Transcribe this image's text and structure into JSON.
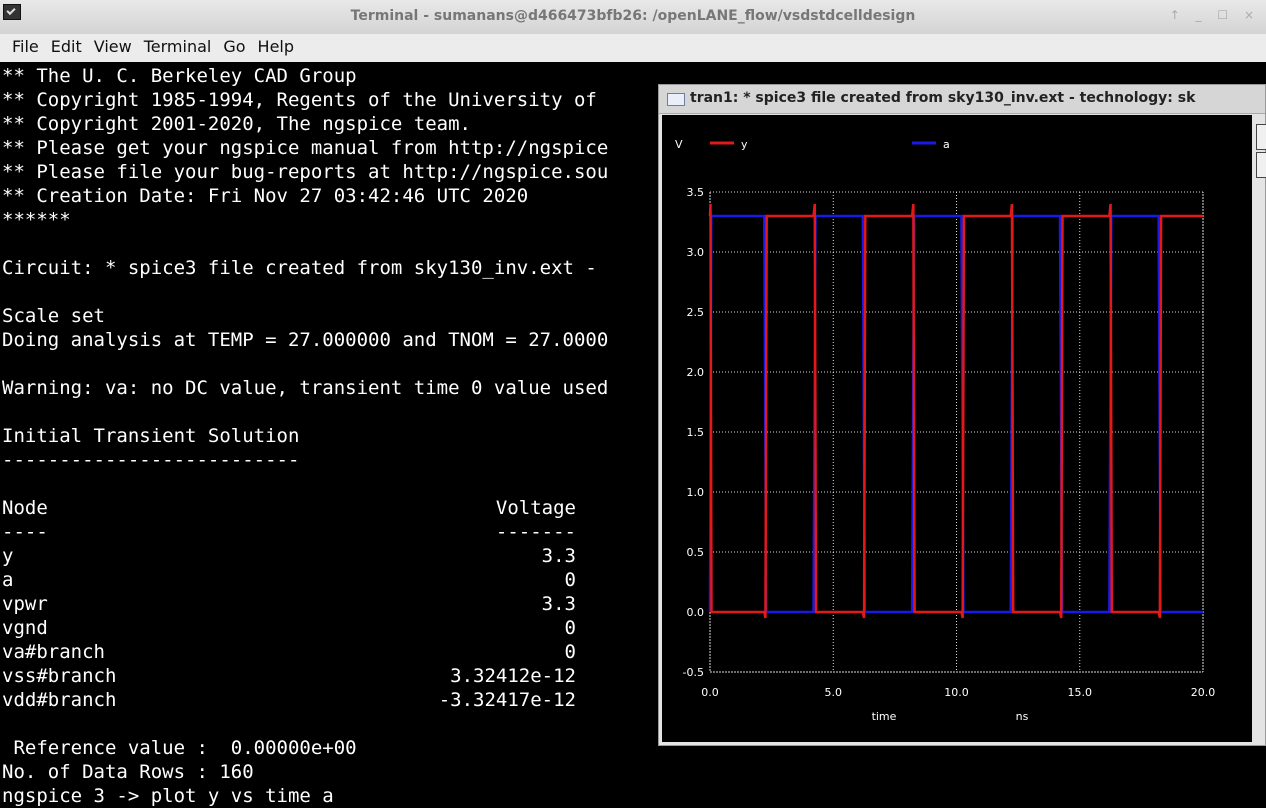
{
  "window": {
    "title": "Terminal - sumanans@d466473bfb26: /openLANE_flow/vsdstdcelldesign",
    "controls": "↑ _ ☐ ×"
  },
  "menu": [
    "File",
    "Edit",
    "View",
    "Terminal",
    "Go",
    "Help"
  ],
  "terminal": {
    "lines": [
      "** The U. C. Berkeley CAD Group",
      "** Copyright 1985-1994, Regents of the University of",
      "** Copyright 2001-2020, The ngspice team.",
      "** Please get your ngspice manual from http://ngspice",
      "** Please file your bug-reports at http://ngspice.sou",
      "** Creation Date: Fri Nov 27 03:42:46 UTC 2020",
      "******",
      "",
      "Circuit: * spice3 file created from sky130_inv.ext -",
      "",
      "Scale set",
      "Doing analysis at TEMP = 27.000000 and TNOM = 27.0000",
      "",
      "Warning: va: no DC value, transient time 0 value used",
      "",
      "Initial Transient Solution",
      "--------------------------",
      "",
      "Node",
      "----",
      "y",
      "a",
      "vpwr",
      "vgnd",
      "va#branch",
      "vss#branch",
      "vdd#branch",
      "",
      " Reference value :  0.00000e+00",
      "No. of Data Rows : 160",
      "ngspice 3 -> plot y vs time a"
    ],
    "values": [
      {
        "row": 18,
        "text": "Voltage"
      },
      {
        "row": 19,
        "text": "-------"
      },
      {
        "row": 20,
        "text": "3.3"
      },
      {
        "row": 21,
        "text": "0"
      },
      {
        "row": 22,
        "text": "3.3"
      },
      {
        "row": 23,
        "text": "0"
      },
      {
        "row": 24,
        "text": "0"
      },
      {
        "row": 25,
        "text": "3.32412e-12"
      },
      {
        "row": 26,
        "text": "-3.32417e-12"
      }
    ]
  },
  "plot_window": {
    "title": "tran1: * spice3 file created from sky130_inv.ext - technology: sk"
  },
  "chart_data": {
    "type": "line",
    "ylabel": "V",
    "xlabel": "time",
    "xunit": "ns",
    "xlim": [
      0,
      20
    ],
    "ylim": [
      -0.5,
      3.5
    ],
    "xticks": [
      "0.0",
      "5.0",
      "10.0",
      "15.0",
      "20.0"
    ],
    "xtick_values": [
      0,
      5,
      10,
      15,
      20
    ],
    "yticks": [
      "-0.5",
      "0.0",
      "0.5",
      "1.0",
      "1.5",
      "2.0",
      "2.5",
      "3.0",
      "3.5"
    ],
    "ytick_values": [
      -0.5,
      0,
      0.5,
      1.0,
      1.5,
      2.0,
      2.5,
      3.0,
      3.5
    ],
    "grid": true,
    "legend": "top",
    "background": "#000000",
    "series": [
      {
        "name": "y",
        "color": "#e11919",
        "x": [
          0,
          0.02,
          0.06,
          2.2,
          2.25,
          2.3,
          2.35,
          4.2,
          4.25,
          4.3,
          6.2,
          6.25,
          6.3,
          6.35,
          8.2,
          8.25,
          8.3,
          10.2,
          10.25,
          10.3,
          10.35,
          12.2,
          12.25,
          12.3,
          14.2,
          14.25,
          14.3,
          14.35,
          16.2,
          16.25,
          16.3,
          18.2,
          18.25,
          18.3,
          18.35,
          20
        ],
        "y": [
          3.3,
          3.4,
          0,
          0,
          -0.05,
          3.3,
          3.3,
          3.3,
          3.4,
          0,
          0,
          -0.05,
          3.3,
          3.3,
          3.3,
          3.4,
          0,
          0,
          -0.05,
          3.3,
          3.3,
          3.3,
          3.4,
          0,
          0,
          -0.05,
          3.3,
          3.3,
          3.3,
          3.4,
          0,
          0,
          -0.05,
          3.3,
          3.3,
          3.3
        ]
      },
      {
        "name": "a",
        "color": "#1a1ae6",
        "x": [
          0,
          0.05,
          0.12,
          2.2,
          2.28,
          4.2,
          4.28,
          6.2,
          6.28,
          8.2,
          8.28,
          10.2,
          10.28,
          12.2,
          12.28,
          14.2,
          14.28,
          16.2,
          16.28,
          18.2,
          18.28,
          20
        ],
        "y": [
          0,
          3.3,
          3.3,
          3.3,
          0,
          0,
          3.3,
          3.3,
          0,
          0,
          3.3,
          3.3,
          0,
          0,
          3.3,
          3.3,
          0,
          0,
          3.3,
          3.3,
          0,
          0
        ]
      }
    ]
  }
}
